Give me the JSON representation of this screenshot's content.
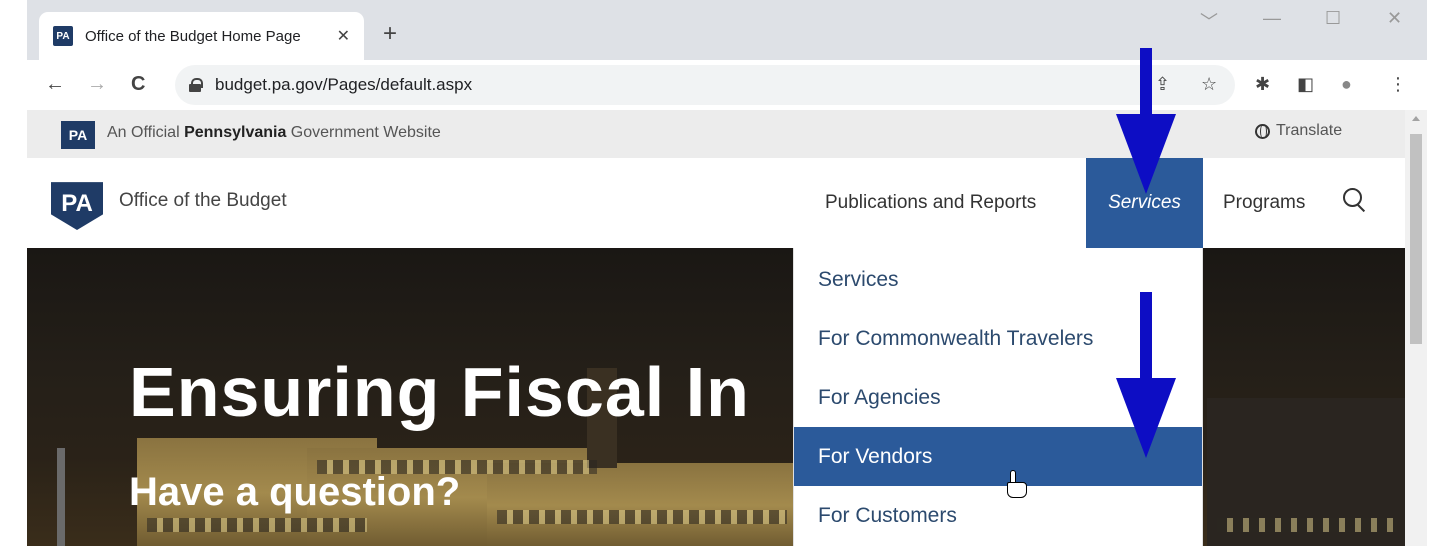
{
  "browser": {
    "tab": {
      "favicon": "PA",
      "title": "Office of the Budget Home Page",
      "close": "✕"
    },
    "new_tab": "+",
    "window_controls": {
      "dropdown": "﹀",
      "minimize": "—",
      "maximize": "☐",
      "close": "✕"
    },
    "nav": {
      "back": "←",
      "forward": "→",
      "reload": "C"
    },
    "url": "budget.pa.gov/Pages/default.aspx",
    "toolbar_icons": {
      "share": "⇪",
      "star": "☆",
      "extensions": "✱",
      "sidepanel": "◧",
      "profile": "●",
      "menu": "⋮"
    }
  },
  "official_banner": {
    "logo": "PA",
    "text_prefix": "An Official ",
    "text_bold": "Pennsylvania",
    "text_suffix": " Government Website",
    "translate": "Translate"
  },
  "header": {
    "logo": "PA",
    "site_title": "Office of the Budget",
    "nav": [
      {
        "label": "Publications and Reports"
      },
      {
        "label": "Services"
      },
      {
        "label": "Programs"
      }
    ]
  },
  "hero": {
    "title": "Ensuring Fiscal In",
    "subtitle": "Have a question?"
  },
  "dropdown": {
    "items": [
      {
        "label": "Services"
      },
      {
        "label": "For Commonwealth Travelers"
      },
      {
        "label": "For Agencies"
      },
      {
        "label": "For Vendors"
      },
      {
        "label": "For Customers"
      }
    ],
    "active_index": 3
  },
  "colors": {
    "accent": "#2b5a9a",
    "brand": "#1f3b66",
    "annotation_arrow": "#0d0dc4"
  }
}
